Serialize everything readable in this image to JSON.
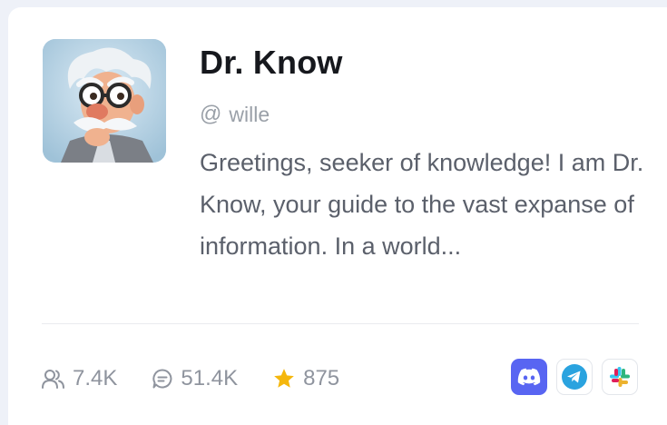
{
  "profile": {
    "name": "Dr. Know",
    "handle_prefix": "@",
    "handle": "wille",
    "description": "Greetings, seeker of knowledge! I am Dr. Know, your guide to the vast expanse of information. In a world...",
    "avatar_icon": "professor-avatar"
  },
  "stats": {
    "users": "7.4K",
    "messages": "51.4K",
    "stars": "875"
  },
  "socials": [
    {
      "name": "discord",
      "color": "#5865f2"
    },
    {
      "name": "telegram",
      "color": "#2aa3df"
    },
    {
      "name": "slack",
      "color": "#e01e5a"
    }
  ],
  "colors": {
    "star": "#f5b70d",
    "text_primary": "#16181d",
    "text_secondary": "#5b606b",
    "muted": "#8f949e"
  }
}
